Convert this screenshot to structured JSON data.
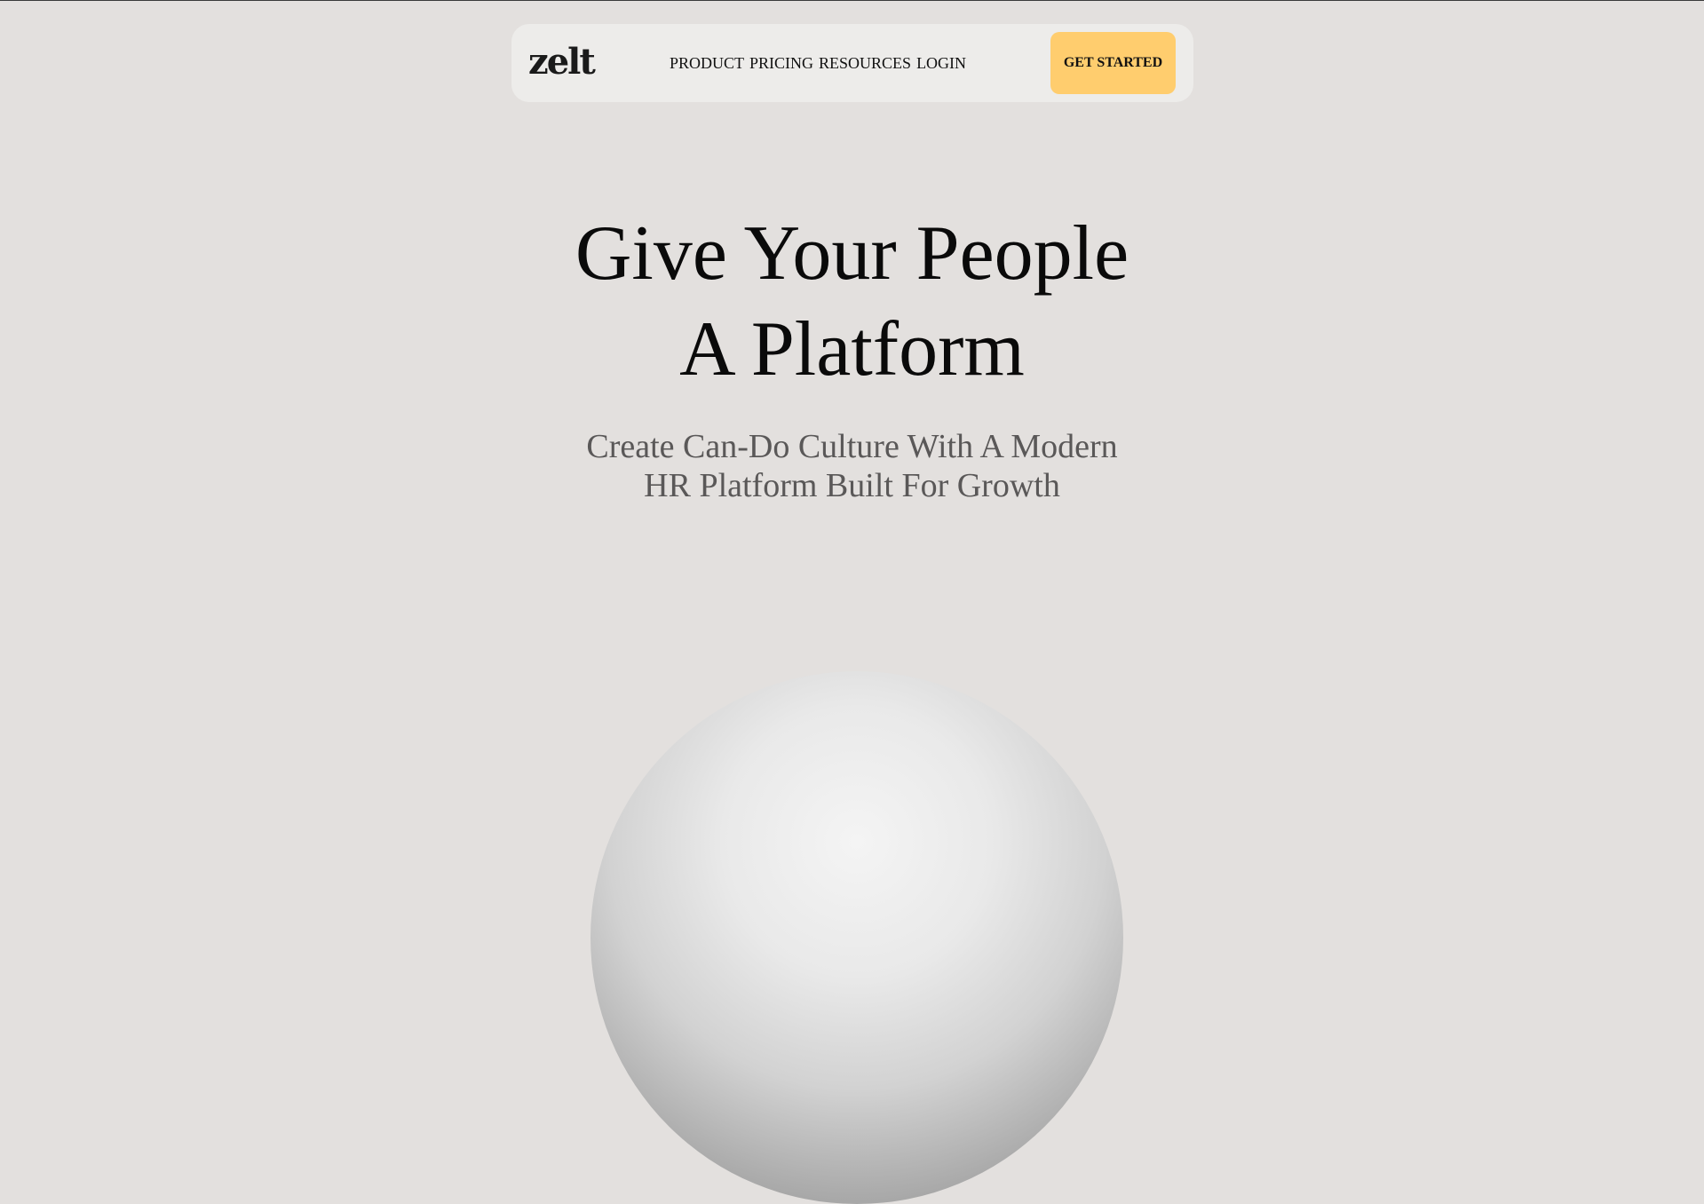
{
  "nav": {
    "logo": "zelt",
    "links": [
      {
        "label": "PRODUCT"
      },
      {
        "label": "PRICING"
      },
      {
        "label": "RESOURCES"
      },
      {
        "label": "LOGIN"
      }
    ],
    "cta_label": "GET STARTED"
  },
  "hero": {
    "title_line1": "Give Your People",
    "title_line2": "A Platform",
    "subtitle_line1": "Create Can-Do Culture With A Modern",
    "subtitle_line2": "HR Platform Built For Growth"
  },
  "colors": {
    "background": "#e3e0de",
    "nav_background": "#edecea",
    "cta_background": "#ffcd6e",
    "subtitle_text": "#5a5858"
  },
  "icons": {
    "hero_visual": "sphere-illustration"
  }
}
